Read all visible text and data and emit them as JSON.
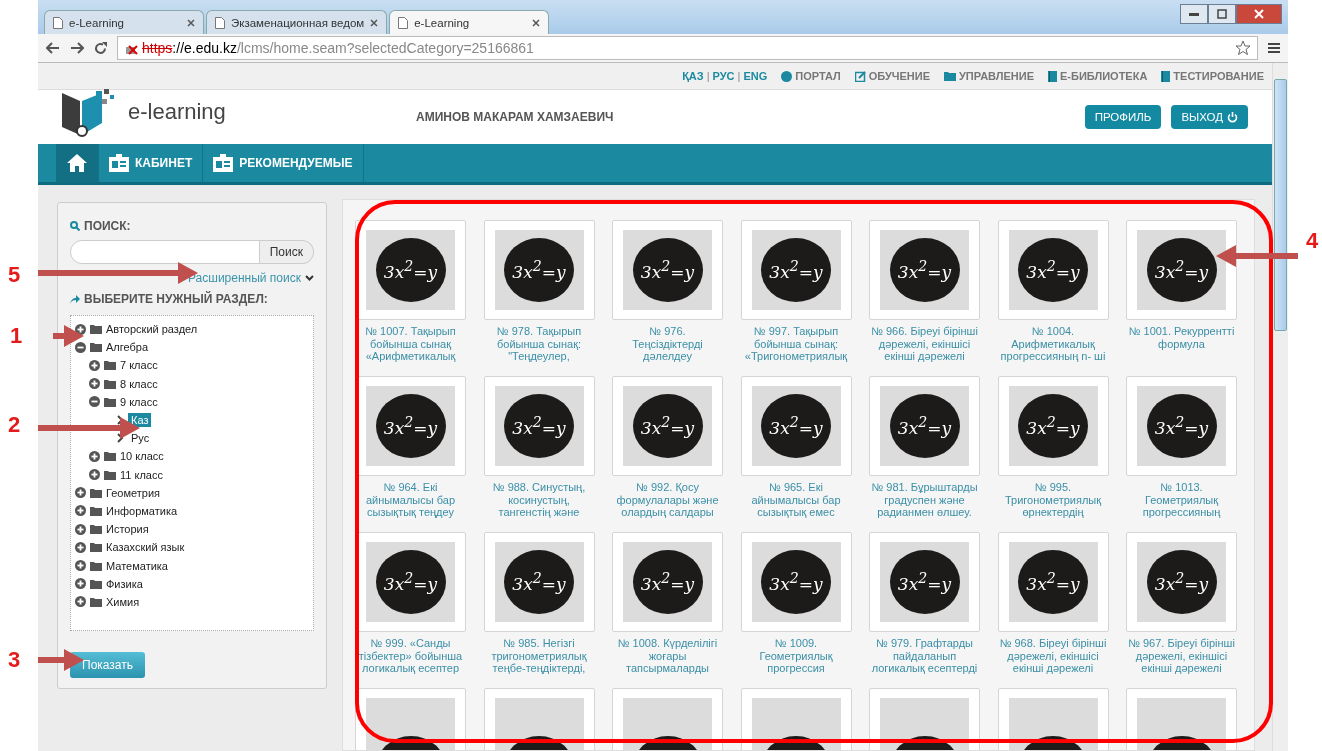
{
  "browser": {
    "tabs": [
      {
        "title": "e-Learning",
        "selected": false
      },
      {
        "title": "Экзаменационная ведом",
        "selected": false
      },
      {
        "title": "e-Learning",
        "selected": true
      }
    ],
    "url_scheme": "https",
    "url_host": "://e.edu.kz",
    "url_path": "/lcms/home.seam?selectedCategory=25166861"
  },
  "top_bar": {
    "languages": [
      "ҚАЗ",
      "РУС",
      "ENG"
    ],
    "language_separator": "|",
    "links": [
      {
        "kind": "globe",
        "label": "ПОРТАЛ"
      },
      {
        "kind": "edit",
        "label": "ОБУЧЕНИЕ"
      },
      {
        "kind": "folder",
        "label": "УПРАВЛЕНИЕ"
      },
      {
        "kind": "book",
        "label": "E-БИБЛИОТЕКА"
      },
      {
        "kind": "book",
        "label": "ТЕСТИРОВАНИЕ"
      }
    ]
  },
  "header": {
    "logo": "e-learning",
    "user": "АМИНОВ МАКАРАМ ХАМЗАЕВИЧ",
    "buttons": [
      {
        "kind": "plain",
        "label": "ПРОФИЛЬ"
      },
      {
        "kind": "power",
        "label": "ВЫХОД"
      }
    ]
  },
  "nav": [
    {
      "kind": "home"
    },
    {
      "kind": "card",
      "label": "КАБИНЕТ"
    },
    {
      "kind": "card",
      "label": "РЕКОМЕНДУЕМЫЕ"
    }
  ],
  "sidebar": {
    "search_title": "ПОИСК:",
    "search_button": "Поиск",
    "advanced_link": "Расширенный поиск",
    "section_title": "ВЫБЕРИТЕ НУЖНЫЙ РАЗДЕЛ:",
    "show_button": "Показать",
    "tree": [
      {
        "kind": "folder",
        "label": "Авторский раздел",
        "expanded": false
      },
      {
        "kind": "folder",
        "label": "Алгебра",
        "expanded": true,
        "children": [
          {
            "kind": "folder",
            "label": "7 класс",
            "expanded": false
          },
          {
            "kind": "folder",
            "label": "8 класс",
            "expanded": false
          },
          {
            "kind": "folder",
            "label": "9 класс",
            "expanded": true,
            "children": [
              {
                "kind": "leaf",
                "label": "Каз",
                "selected": true
              },
              {
                "kind": "leaf",
                "label": "Рус",
                "selected": false
              }
            ]
          },
          {
            "kind": "folder",
            "label": "10 класс",
            "expanded": false
          },
          {
            "kind": "folder",
            "label": "11 класс",
            "expanded": false
          }
        ]
      },
      {
        "kind": "folder",
        "label": "Геометрия",
        "expanded": false
      },
      {
        "kind": "folder",
        "label": "Информатика",
        "expanded": false
      },
      {
        "kind": "folder",
        "label": "История",
        "expanded": false
      },
      {
        "kind": "folder",
        "label": "Казахский язык",
        "expanded": false
      },
      {
        "kind": "folder",
        "label": "Математика",
        "expanded": false
      },
      {
        "kind": "folder",
        "label": "Физика",
        "expanded": false
      },
      {
        "kind": "folder",
        "label": "Химия",
        "expanded": false
      }
    ]
  },
  "cards": [
    {
      "thumbnail": "3x$^{2}$=y",
      "title": "№ 1007. Тақырып бойынша сынақ «Арифметикалық"
    },
    {
      "thumbnail": "3x$^{2}$=y",
      "title": "№ 978. Тақырып бойынша сынақ: \"Теңдеулер,"
    },
    {
      "thumbnail": "3x$^{2}$=y",
      "title": "№ 976. Теңсіздіктерді дәлелдеу"
    },
    {
      "thumbnail": "3x$^{2}$=y",
      "title": "№ 997. Тақырып бойынша сынақ: «Тригонометриялық"
    },
    {
      "thumbnail": "3x$^{2}$=y",
      "title": "№ 966. Біреуі бірінші дәрежелі, екіншісі екінші дәрежелі"
    },
    {
      "thumbnail": "3x$^{2}$=y",
      "title": "№ 1004. Арифметикалық прогрессияның n- ші"
    },
    {
      "thumbnail": "3x$^{2}$=y",
      "title": "№ 1001. Рекуррентті формула"
    },
    {
      "thumbnail": "3x$^{2}$=y",
      "title": "№ 964. Екі айнымалысы бар сызықтық теңдеу"
    },
    {
      "thumbnail": "3x$^{2}$=y",
      "title": "№ 988. Синустың, косинустың, тангенстің және"
    },
    {
      "thumbnail": "3x$^{2}$=y",
      "title": "№ 992. Қосу формулалары және олардың салдары"
    },
    {
      "thumbnail": "3x$^{2}$=y",
      "title": "№ 965. Екі айнымалысы бар сызықтық емес"
    },
    {
      "thumbnail": "3x$^{2}$=y",
      "title": "№ 981. Бұрыштарды градуспен және радианмен өлшеу."
    },
    {
      "thumbnail": "3x$^{2}$=y",
      "title": "№ 995. Тригонометриялық өрнектердің"
    },
    {
      "thumbnail": "3x$^{2}$=y",
      "title": "№ 1013. Геометриялық прогрессияның"
    },
    {
      "thumbnail": "3x$^{2}$=y",
      "title": "№ 999. «Санды тізбектер» бойынша логикалық есептер"
    },
    {
      "thumbnail": "3x$^{2}$=y",
      "title": "№ 985. Негізгі тригонометриялық теңбе-теңдіктерді,"
    },
    {
      "thumbnail": "3x$^{2}$=y",
      "title": "№ 1008. Күрделілігі жоғары тапсырмаларды"
    },
    {
      "thumbnail": "3x$^{2}$=y",
      "title": "№ 1009. Геометриялық прогрессия"
    },
    {
      "thumbnail": "3x$^{2}$=y",
      "title": "№ 979. Графтарды пайдаланып логикалық есептерді"
    },
    {
      "thumbnail": "3x$^{2}$=y",
      "title": "№ 968. Біреуі бірінші дәрежелі, екіншісі екінші дәрежелі"
    },
    {
      "thumbnail": "3x$^{2}$=y",
      "title": "№ 967. Біреуі бірінші дәрежелі, екіншісі екінші дәрежелі"
    },
    {
      "kind": "cut"
    },
    {
      "kind": "cut"
    },
    {
      "kind": "cut"
    },
    {
      "kind": "cut"
    },
    {
      "kind": "cut"
    },
    {
      "kind": "cut"
    },
    {
      "kind": "cut"
    }
  ],
  "annotations": [
    {
      "number": "5"
    },
    {
      "number": "1"
    },
    {
      "number": "2"
    },
    {
      "number": "3"
    },
    {
      "number": "4"
    }
  ]
}
